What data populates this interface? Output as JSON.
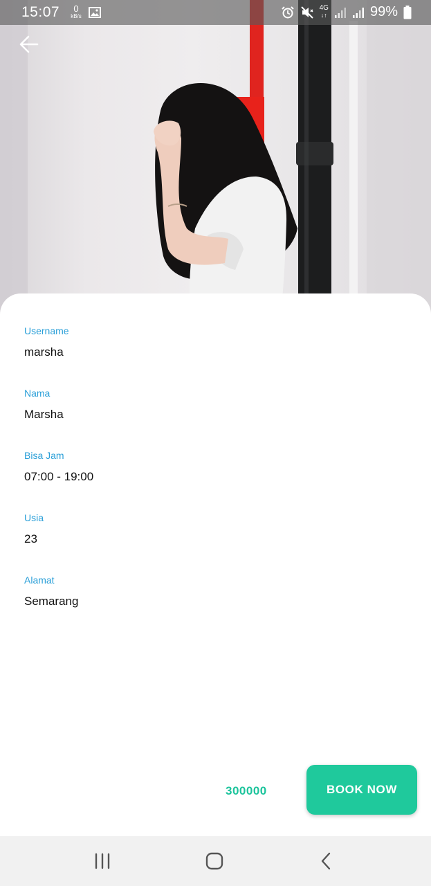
{
  "status_bar": {
    "time": "15:07",
    "data_speed_value": "0",
    "data_speed_unit": "kB/s",
    "network": "4G",
    "battery": "99%"
  },
  "hero": {
    "description_icon": "person-photo"
  },
  "profile": {
    "fields": [
      {
        "label": "Username",
        "value": "marsha"
      },
      {
        "label": "Nama",
        "value": "Marsha"
      },
      {
        "label": "Bisa Jam",
        "value": "07:00 - 19:00"
      },
      {
        "label": "Usia",
        "value": "23"
      },
      {
        "label": "Alamat",
        "value": "Semarang"
      }
    ]
  },
  "booking": {
    "price": "300000",
    "button_label": "BOOK NOW"
  },
  "colors": {
    "label": "#2a9fd8",
    "accent": "#1fc99c",
    "price": "#1cc49c"
  },
  "icons": {
    "back": "arrow-left-icon",
    "nav_recents": "recents-icon",
    "nav_home": "home-icon",
    "nav_back": "chevron-left-icon"
  }
}
